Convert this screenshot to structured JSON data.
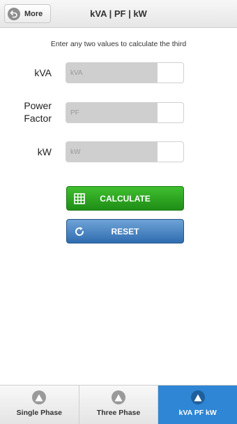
{
  "header": {
    "more_label": "More",
    "title": "kVA | PF | kW"
  },
  "instruction": "Enter any two values to calculate the third",
  "fields": {
    "kva": {
      "label": "kVA",
      "placeholder": "kVA",
      "value": ""
    },
    "pf": {
      "label_line1": "Power",
      "label_line2": "Factor",
      "placeholder": "PF",
      "value": ""
    },
    "kw": {
      "label": "kW",
      "placeholder": "kW",
      "value": ""
    }
  },
  "buttons": {
    "calculate_label": "CALCULATE",
    "reset_label": "RESET"
  },
  "tabs": [
    {
      "label": "Single Phase",
      "icon": "triangle-warning-icon",
      "active": false
    },
    {
      "label": "Three Phase",
      "icon": "triangle-warning-icon",
      "active": false
    },
    {
      "label": "kVA PF kW",
      "icon": "triangle-warning-icon",
      "active": true
    }
  ],
  "colors": {
    "calculate_button": "#2aa520",
    "reset_button": "#4a86c4",
    "active_tab": "#2e86d4"
  }
}
